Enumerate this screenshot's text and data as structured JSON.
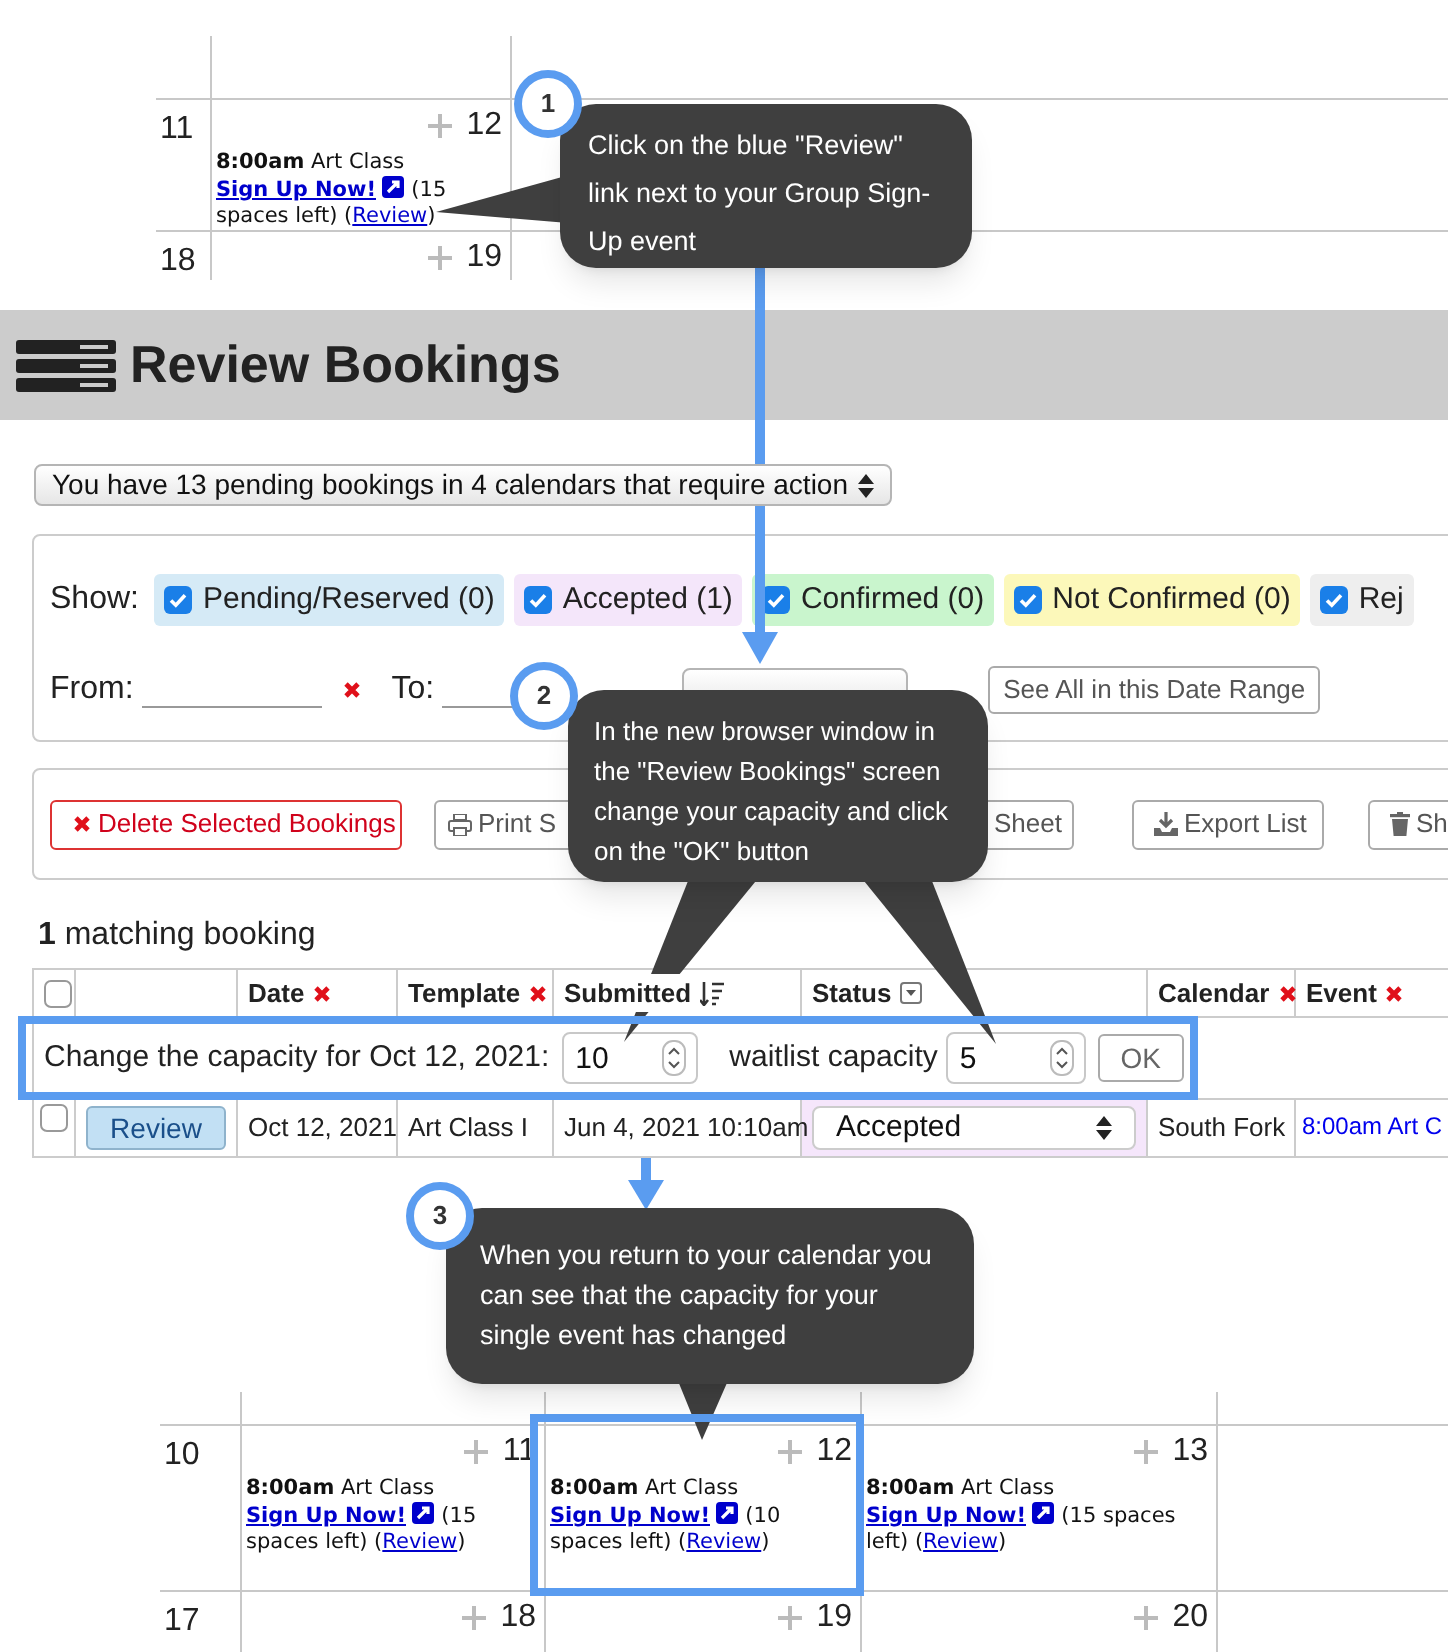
{
  "top_calendar": {
    "weeks": [
      {
        "days": [
          {
            "kind": "edge",
            "date": "11"
          },
          {
            "kind": "day",
            "date": "12",
            "events": [
              {
                "text": "**8:00am** Art Class",
                "signup_link": "Sign Up Now!",
                "spaces": "(15 spaces left)",
                "review_open": "(",
                "review_link": "Review",
                "review_close": ")"
              }
            ]
          }
        ]
      },
      {
        "days": [
          {
            "kind": "edge",
            "date": "18"
          },
          {
            "kind": "day",
            "date": "19"
          }
        ]
      }
    ]
  },
  "header": {
    "title": "Review Bookings"
  },
  "pending_select": {
    "value": "You have 13 pending bookings in 4 calendars that require action"
  },
  "filters": {
    "label": "Show:",
    "statuses": [
      {
        "label": "Pending/Reserved (0)",
        "checked": true,
        "color": "#d5eaf6"
      },
      {
        "label": "Accepted (1)",
        "checked": true,
        "color": "#f4e6fa"
      },
      {
        "label": "Confirmed (0)",
        "checked": true,
        "color": "#c9f5cd"
      },
      {
        "label": "Not Confirmed (0)",
        "checked": true,
        "color": "#fcf8ba"
      },
      {
        "label": "Rej",
        "checked": true,
        "color": "#eeeeee"
      }
    ],
    "from_label": "From:",
    "to_label": "To:",
    "see_all_button": "See All in this Date Range"
  },
  "actions": [
    {
      "kind": "delete",
      "label": "Delete Selected Bookings"
    },
    {
      "kind": "print",
      "label": "Print S"
    },
    {
      "kind": "plain",
      "label": "Sheet"
    },
    {
      "kind": "export",
      "label": "Export List"
    },
    {
      "kind": "trash",
      "label": "Sh"
    }
  ],
  "results": {
    "summary": "**1** matching booking"
  },
  "table": {
    "columns": [
      {
        "kind": "checkbox",
        "checked": false
      },
      {
        "kind": "blank"
      },
      {
        "kind": "removable",
        "label": "Date"
      },
      {
        "kind": "removable",
        "label": "Template"
      },
      {
        "kind": "sortable",
        "label": "Submitted"
      },
      {
        "kind": "filter",
        "label": "Status"
      },
      {
        "kind": "removable",
        "label": "Calendar"
      },
      {
        "kind": "removable",
        "label": "Event"
      }
    ],
    "capacity_row": {
      "label": "Change the capacity for Oct 12, 2021:",
      "capacity": "10",
      "waitlist_label": "waitlist capacity",
      "waitlist": "5",
      "ok_button": "OK"
    },
    "rows": [
      {
        "checked": false,
        "review_button": "Review",
        "date": "Oct 12, 2021",
        "template": "Art Class I",
        "submitted": "Jun 4, 2021 10:10am",
        "status": "Accepted",
        "calendar": "South Fork",
        "event": "8:00am Art C"
      }
    ]
  },
  "bottom_calendar": {
    "weeks": [
      {
        "days": [
          {
            "kind": "edge",
            "date": "10"
          },
          {
            "kind": "day",
            "date": "11",
            "events": [
              {
                "text": "**8:00am** Art Class",
                "signup_link": "Sign Up Now!",
                "spaces": "(15 spaces left)",
                "review_open": "(",
                "review_link": "Review",
                "review_close": ")"
              }
            ]
          },
          {
            "kind": "day",
            "date": "12",
            "events": [
              {
                "text": "**8:00am** Art Class",
                "signup_link": "Sign Up Now!",
                "spaces": "(10 spaces left)",
                "review_open": "(",
                "review_link": "Review",
                "review_close": ")"
              }
            ]
          },
          {
            "kind": "day",
            "date": "13",
            "events": [
              {
                "text": "**8:00am** Art Class",
                "signup_link": "Sign Up Now!",
                "spaces": "(15 spaces left)",
                "review_open": "(",
                "review_link": "Review",
                "review_close": ")"
              }
            ]
          }
        ]
      },
      {
        "days": [
          {
            "kind": "edge",
            "date": "17"
          },
          {
            "kind": "day",
            "date": "18"
          },
          {
            "kind": "day",
            "date": "19"
          },
          {
            "kind": "day",
            "date": "20"
          }
        ]
      }
    ]
  },
  "callouts": [
    {
      "number": "1",
      "text": "Click on the blue \"Review\" link next to your Group Sign-Up event"
    },
    {
      "number": "2",
      "text": "In the new browser window in the \"Review Bookings\" screen change your capacity and click on the \"OK\" button"
    },
    {
      "number": "3",
      "text": "When you return to your calendar you can see that the capacity for your single event has changed"
    }
  ]
}
